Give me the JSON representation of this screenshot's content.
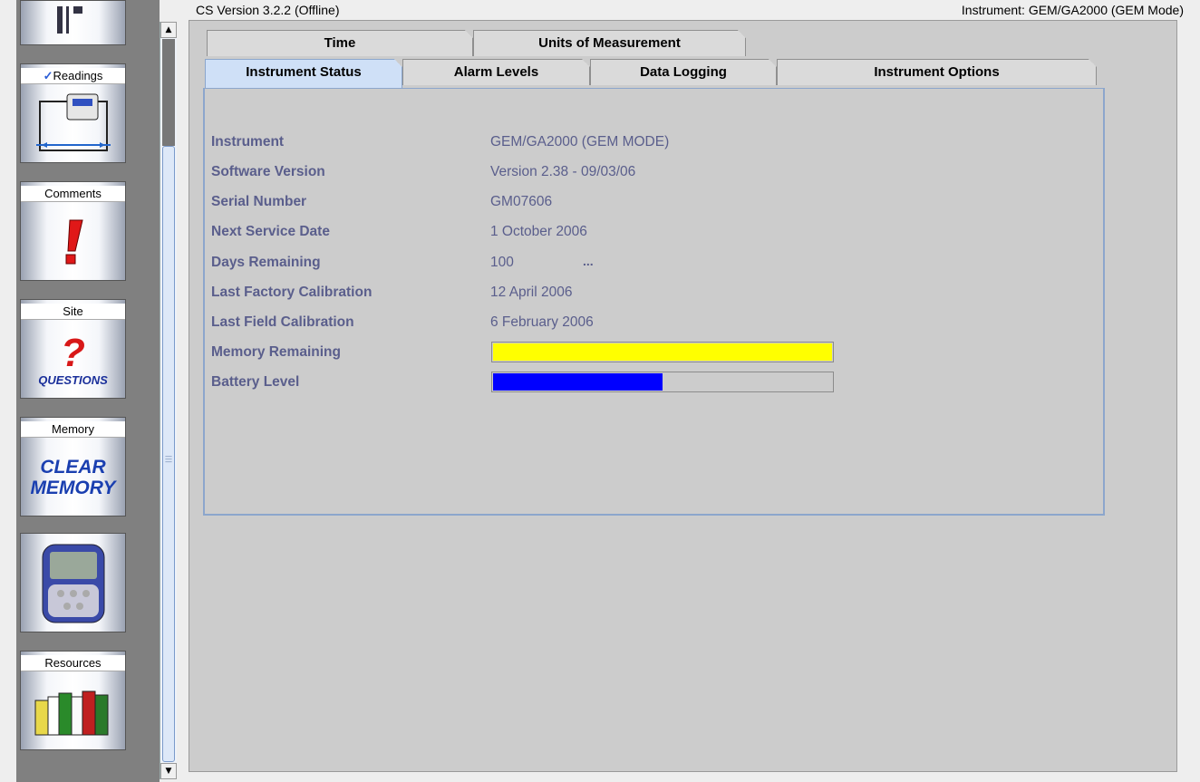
{
  "header": {
    "left_text": "CS Version 3.2.2 (Offline)",
    "right_text": "Instrument: GEM/GA2000 (GEM Mode)"
  },
  "sidebar": {
    "items": [
      {
        "label": "",
        "icon": "partial-top-icon"
      },
      {
        "label": "Readings",
        "icon": "readings-icon"
      },
      {
        "label": "Comments",
        "icon": "exclamation-icon"
      },
      {
        "label": "Site",
        "icon": "questions-icon",
        "art_text": "QUESTIONS"
      },
      {
        "label": "Memory",
        "icon": "clear-memory-icon",
        "art_text": "CLEAR\nMEMORY"
      },
      {
        "label": "",
        "icon": "instrument-device-icon"
      },
      {
        "label": "Resources",
        "icon": "books-icon"
      }
    ]
  },
  "tabs": {
    "row1": [
      "Time",
      "Units of Measurement"
    ],
    "row2": [
      "Instrument Status",
      "Alarm Levels",
      "Data Logging",
      "Instrument Options"
    ],
    "active": "Instrument Status"
  },
  "status": {
    "fields": [
      {
        "label": "Instrument",
        "value": "GEM/GA2000 (GEM MODE)"
      },
      {
        "label": "Software Version",
        "value": "Version 2.38 - 09/03/06"
      },
      {
        "label": "Serial Number",
        "value": "GM07606"
      },
      {
        "label": "Next Service Date",
        "value": "1 October 2006"
      },
      {
        "label": "Days Remaining",
        "value": "100"
      },
      {
        "label": "Last Factory Calibration",
        "value": "12 April 2006"
      },
      {
        "label": "Last Field Calibration",
        "value": "6 February 2006"
      }
    ],
    "days_more": "...",
    "memory_label": "Memory Remaining",
    "battery_label": "Battery Level",
    "memory_fraction": 1.0,
    "battery_fraction": 0.5,
    "memory_color": "#ffff00",
    "battery_color": "#0000ff"
  }
}
